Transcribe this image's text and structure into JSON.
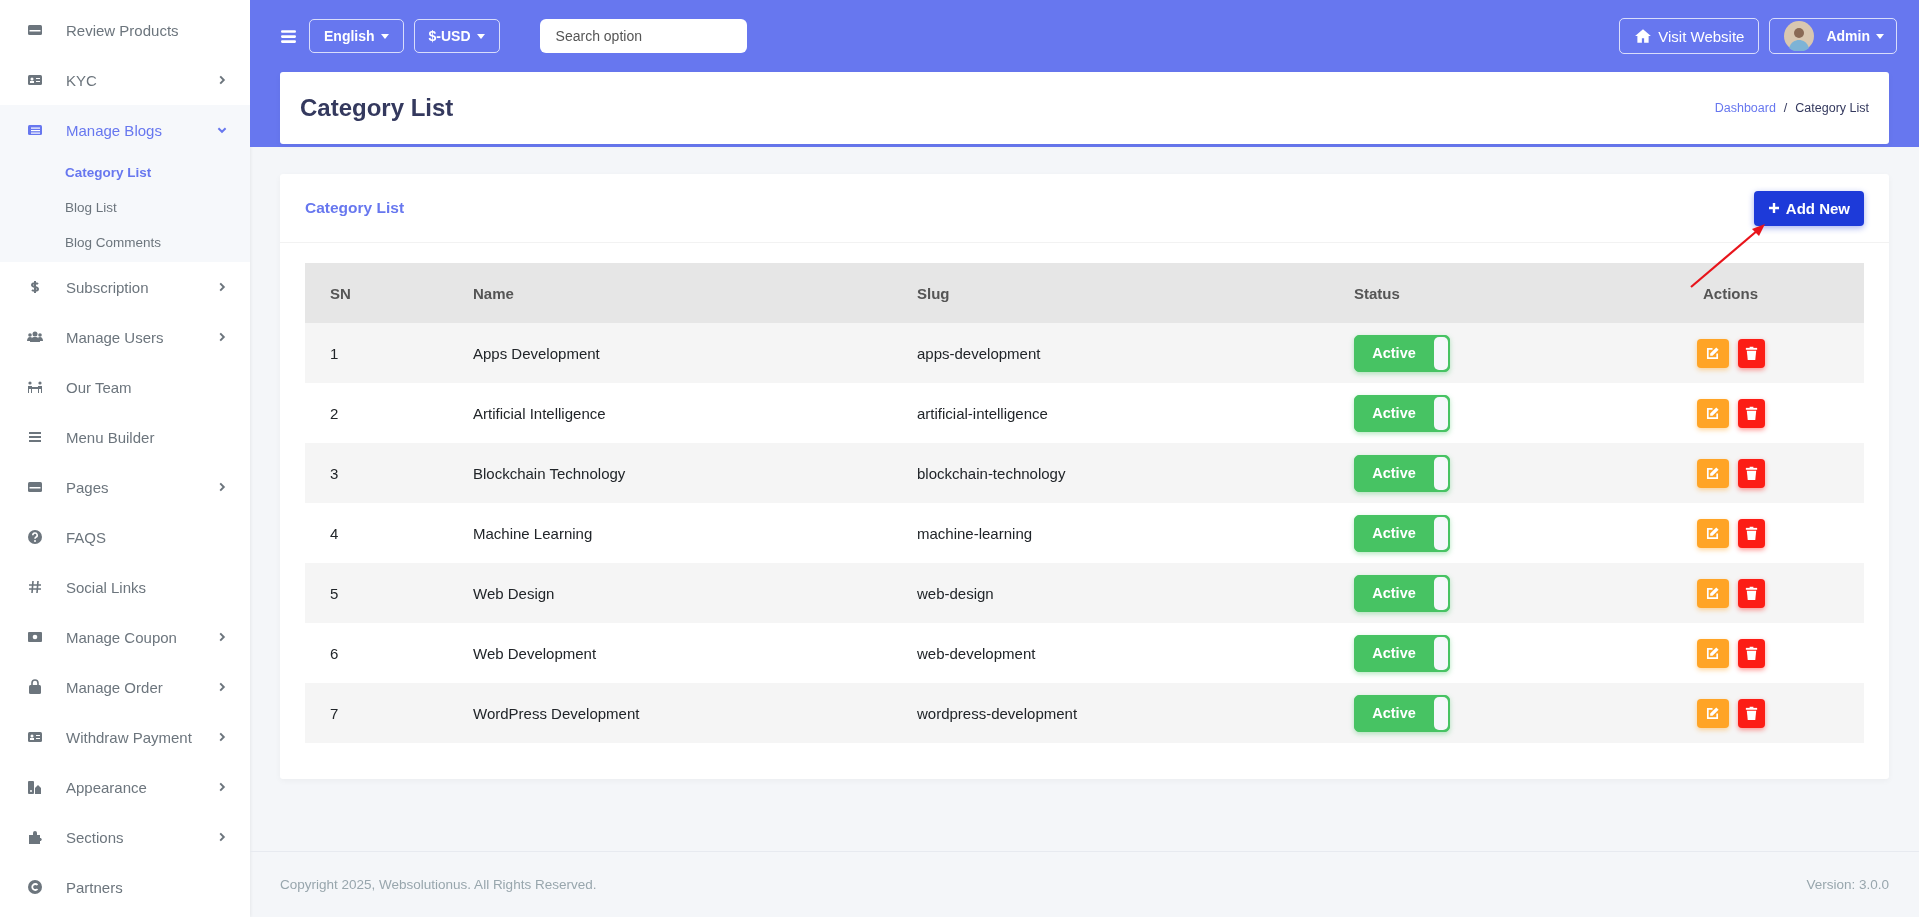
{
  "sidebar": {
    "items": [
      {
        "label": "Review Products",
        "selected": false
      },
      {
        "label": "KYC",
        "expanded": false,
        "selected": false
      },
      {
        "label": "Manage Blogs",
        "expanded": true,
        "selected": true,
        "children": [
          {
            "label": "Category List",
            "selected": true
          },
          {
            "label": "Blog List",
            "selected": false
          },
          {
            "label": "Blog Comments",
            "selected": false
          }
        ]
      },
      {
        "label": "Subscription",
        "expanded": false,
        "selected": false
      },
      {
        "label": "Manage Users",
        "expanded": false,
        "selected": false
      },
      {
        "label": "Our Team",
        "selected": false
      },
      {
        "label": "Menu Builder",
        "selected": false
      },
      {
        "label": "Pages",
        "expanded": false,
        "selected": false
      },
      {
        "label": "FAQS",
        "selected": false
      },
      {
        "label": "Social Links",
        "selected": false
      },
      {
        "label": "Manage Coupon",
        "expanded": false,
        "selected": false
      },
      {
        "label": "Manage Order",
        "expanded": false,
        "selected": false
      },
      {
        "label": "Withdraw Payment",
        "expanded": false,
        "selected": false
      },
      {
        "label": "Appearance",
        "expanded": false,
        "selected": false
      },
      {
        "label": "Sections",
        "expanded": false,
        "selected": false
      },
      {
        "label": "Partners",
        "selected": false
      }
    ]
  },
  "topbar": {
    "language": "English",
    "currency": "$-USD",
    "search": {
      "placeholder": "Search option"
    },
    "visit_button": "Visit Website",
    "user": "Admin"
  },
  "page_header": {
    "title": "Category List",
    "breadcrumb": [
      "Dashboard",
      "Category List"
    ],
    "breadcrumb_separator": "/"
  },
  "card": {
    "title": "Category List",
    "add_button": "Add New",
    "table": {
      "columns": [
        "SN",
        "Name",
        "Slug",
        "Status",
        "Actions"
      ],
      "rows": [
        {
          "sn": "1",
          "name": "Apps Development",
          "slug": "apps-development",
          "status": {
            "label": "Active",
            "on": true
          }
        },
        {
          "sn": "2",
          "name": "Artificial Intelligence",
          "slug": "artificial-intelligence",
          "status": {
            "label": "Active",
            "on": true
          }
        },
        {
          "sn": "3",
          "name": "Blockchain Technology",
          "slug": "blockchain-technology",
          "status": {
            "label": "Active",
            "on": true
          }
        },
        {
          "sn": "4",
          "name": "Machine Learning",
          "slug": "machine-learning",
          "status": {
            "label": "Active",
            "on": true
          }
        },
        {
          "sn": "5",
          "name": "Web Design",
          "slug": "web-design",
          "status": {
            "label": "Active",
            "on": true
          }
        },
        {
          "sn": "6",
          "name": "Web Development",
          "slug": "web-development",
          "status": {
            "label": "Active",
            "on": true
          }
        },
        {
          "sn": "7",
          "name": "WordPress Development",
          "slug": "wordpress-development",
          "status": {
            "label": "Active",
            "on": true
          }
        }
      ]
    }
  },
  "footer": {
    "copyright": "Copyright 2025, Websolutionus. All Rights Reserved.",
    "version": "Version: 3.0.0"
  }
}
